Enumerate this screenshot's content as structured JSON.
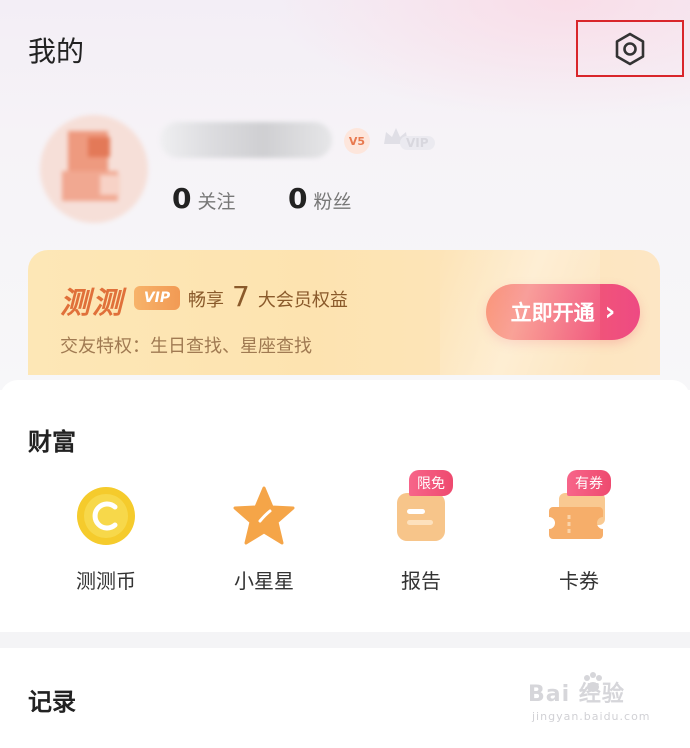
{
  "header": {
    "title": "我的"
  },
  "profile": {
    "level": "V5",
    "vip_label": "VIP",
    "following_count": "0",
    "following_label": "关注",
    "fans_count": "0",
    "fans_label": "粉丝"
  },
  "vip_card": {
    "brand": "测测",
    "vip_chip": "VIP",
    "perk_prefix": "畅享",
    "perk_count": "7",
    "perk_suffix": "大会员权益",
    "subtitle": "交友特权：生日查找、星座查找",
    "open_button": "立即开通",
    "open_button_arrow": "›"
  },
  "wealth": {
    "title": "财富",
    "items": [
      {
        "label": "测测币",
        "icon": "coin-icon",
        "color": "#f5cb2c"
      },
      {
        "label": "小星星",
        "icon": "star-icon",
        "color": "#f5a548"
      },
      {
        "label": "报告",
        "icon": "report-icon",
        "tag": "限免",
        "color": "#f7c58a"
      },
      {
        "label": "卡券",
        "icon": "ticket-icon",
        "tag": "有券",
        "color": "#f6ae6a"
      }
    ]
  },
  "record": {
    "title": "记录"
  },
  "watermark": {
    "main": "Bai  经验",
    "sub": "jingyan.baidu.com"
  },
  "colors": {
    "highlight_border": "#d9262b",
    "vip_brand": "#e0703a",
    "button_gradient_start": "#f87a57",
    "button_gradient_end": "#ee4a83",
    "tag_pink": "#ee4a6f"
  }
}
